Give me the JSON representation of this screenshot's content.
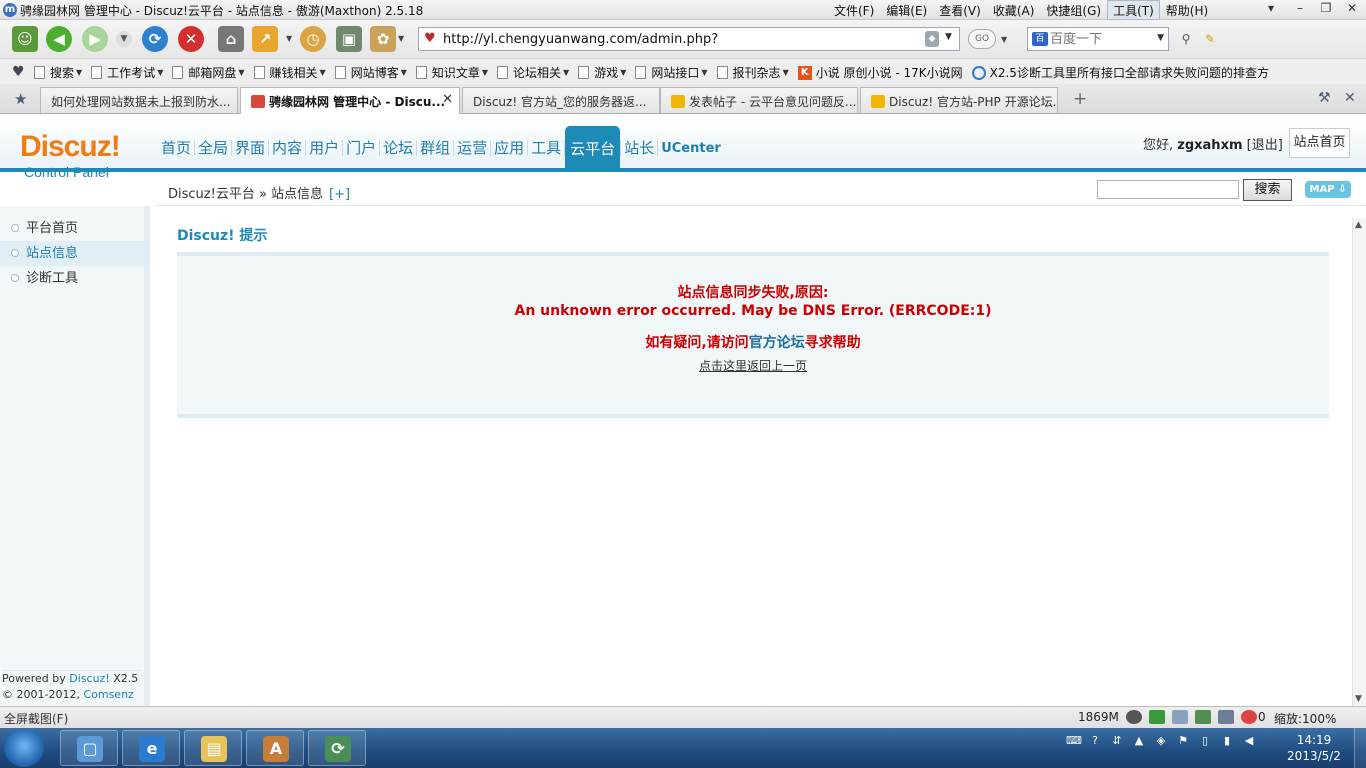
{
  "window": {
    "title": "骋缘园林网 管理中心 - Discuz!云平台 - 站点信息 - 傲游(Maxthon) 2.5.18",
    "menus": [
      "文件(F)",
      "编辑(E)",
      "查看(V)",
      "收藏(A)",
      "快捷组(G)",
      "工具(T)",
      "帮助(H)"
    ],
    "active_menu_index": 5
  },
  "address_bar": {
    "url": "http://yl.chengyuanwang.com/admin.php?",
    "go_label": "GO",
    "search_placeholder": "百度一下"
  },
  "favorites": [
    {
      "label": "搜索",
      "dropdown": true,
      "icon": "page-icon"
    },
    {
      "label": "工作考试",
      "dropdown": true,
      "icon": "page-icon"
    },
    {
      "label": "邮箱网盘",
      "dropdown": true,
      "icon": "page-icon"
    },
    {
      "label": "赚钱相关",
      "dropdown": true,
      "icon": "page-icon"
    },
    {
      "label": "网站博客",
      "dropdown": true,
      "icon": "page-icon"
    },
    {
      "label": "知识文章",
      "dropdown": true,
      "icon": "page-icon"
    },
    {
      "label": "论坛相关",
      "dropdown": true,
      "icon": "page-icon"
    },
    {
      "label": "游戏",
      "dropdown": true,
      "icon": "page-icon"
    },
    {
      "label": "网站接口",
      "dropdown": true,
      "icon": "page-icon"
    },
    {
      "label": "报刊杂志",
      "dropdown": true,
      "icon": "page-icon"
    },
    {
      "label": "小说 原创小说 - 17K小说网",
      "dropdown": false,
      "icon": "17k-icon"
    },
    {
      "label": "X2.5诊断工具里所有接口全部请求失败问题的排查方",
      "dropdown": false,
      "icon": "discuz-x-icon"
    }
  ],
  "tabs": [
    {
      "label": "如何处理网站数据未上报到防水...",
      "active": false
    },
    {
      "label": "骋缘园林网 管理中心 - Discu...",
      "active": true
    },
    {
      "label": "Discuz! 官方站_您的服务器返...",
      "active": false
    },
    {
      "label": "发表帖子 - 云平台意见问题反...",
      "active": false
    },
    {
      "label": "Discuz! 官方站-PHP 开源论坛...",
      "active": false
    }
  ],
  "cp": {
    "logo_main": "Discuz!",
    "logo_sub": "Control Panel",
    "nav": [
      "首页",
      "全局",
      "界面",
      "内容",
      "用户",
      "门户",
      "论坛",
      "群组",
      "运营",
      "应用",
      "工具",
      "云平台",
      "站长",
      "UCenter"
    ],
    "active_nav_index": 11,
    "greeting": "您好,",
    "username": "zgxahxm",
    "logout": "[退出]",
    "site_home": "站点首页",
    "breadcrumb": "Discuz!云平台 » 站点信息",
    "breadcrumb_plus": "[+]",
    "search_button": "搜索",
    "map_button": "MAP",
    "sidebar": [
      {
        "label": "平台首页",
        "active": false
      },
      {
        "label": "站点信息",
        "active": true
      },
      {
        "label": "诊断工具",
        "active": false
      }
    ],
    "powered_by": "Powered by",
    "powered_name": "Discuz!",
    "powered_version": "X2.5",
    "copyright": "© 2001-2012,",
    "copyright_company": "Comsenz Inc.",
    "notice_title": "Discuz! 提示",
    "message": {
      "line1": "站点信息同步失败,原因:",
      "line2": "An unknown error occurred. May be DNS Error. (ERRCODE:1)",
      "line3_prefix": "如有疑问,请访问",
      "line3_link": "官方论坛",
      "line3_suffix": "寻求帮助",
      "back_link": "点击这里返回上一页"
    }
  },
  "status_bar": {
    "left": "全屏截图(F)",
    "memory": "1869M",
    "blocked_count": "0",
    "zoom": "缩放:100%"
  },
  "taskbar": {
    "time": "14:19",
    "date": "2013/5/2"
  },
  "colors": {
    "accent": "#1e8ab8",
    "logo_orange": "#ef7d13",
    "error_red": "#cc0000"
  }
}
